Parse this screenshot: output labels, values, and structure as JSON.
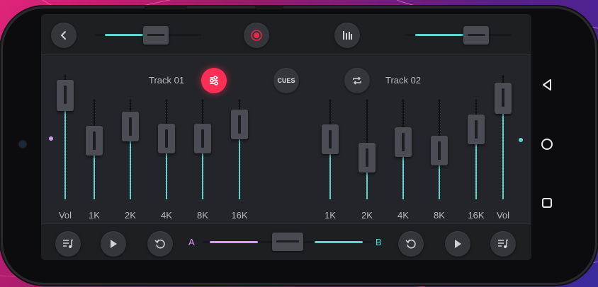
{
  "colors": {
    "accent_cyan": "#5ed3cf",
    "accent_violet": "#d59bf5",
    "record_red": "#e8274a",
    "eq_active": "#ff2e55"
  },
  "top_bar": {
    "back_icon": "chevron-left-icon",
    "record_icon": "record-icon",
    "levels_icon": "vertical-bars-icon",
    "left_slider_level": 0.6,
    "right_slider_level": 0.72
  },
  "deck_a": {
    "title": "Track 01",
    "eq_button_icon": "sliders-icon",
    "faders": [
      {
        "label": "Vol",
        "level": 0.95
      },
      {
        "label": "1K",
        "level": 0.62
      },
      {
        "label": "2K",
        "level": 0.82
      },
      {
        "label": "4K",
        "level": 0.65
      },
      {
        "label": "8K",
        "level": 0.65
      },
      {
        "label": "16K",
        "level": 0.85
      }
    ]
  },
  "center": {
    "cues_label": "CUES"
  },
  "deck_b": {
    "title": "Track 02",
    "swap_button_icon": "swap-arrows-icon",
    "faders": [
      {
        "label": "1K",
        "level": 0.64
      },
      {
        "label": "2K",
        "level": 0.38
      },
      {
        "label": "4K",
        "level": 0.6
      },
      {
        "label": "8K",
        "level": 0.48
      },
      {
        "label": "16K",
        "level": 0.78
      },
      {
        "label": "Vol",
        "level": 0.92
      }
    ]
  },
  "crossfader": {
    "label_a": "A",
    "label_b": "B",
    "position": 0.5
  },
  "bottom_bar": {
    "left_playlist_icon": "playlist-music-icon",
    "left_play_icon": "play-icon",
    "left_reset_icon": "rotate-left-icon",
    "right_reset_icon": "rotate-left-icon",
    "right_play_icon": "play-icon",
    "right_playlist_icon": "playlist-music-icon"
  },
  "system_nav": {
    "back_icon": "triangle-back-icon",
    "home_icon": "circle-home-icon",
    "recents_icon": "square-recents-icon"
  }
}
